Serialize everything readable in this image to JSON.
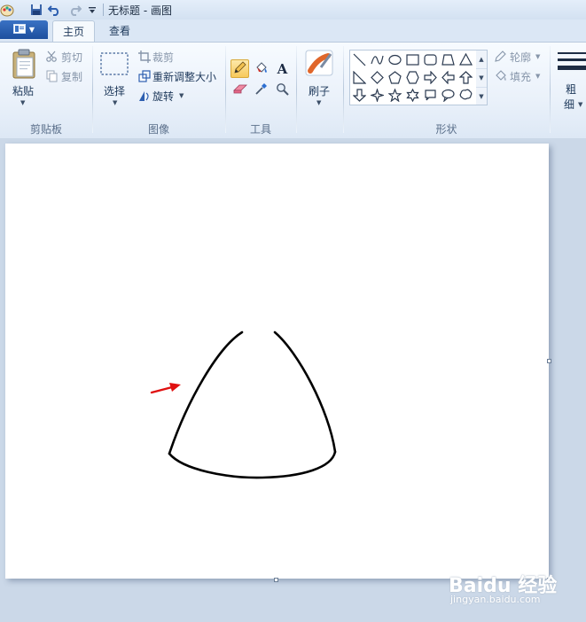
{
  "titlebar": {
    "title": "无标题 - 画图",
    "icons": [
      "paint-app-icon",
      "save-icon",
      "undo-icon",
      "redo-icon",
      "customize-dropdown-icon"
    ]
  },
  "tabs": {
    "app_menu_icon": "menu-icon",
    "items": [
      {
        "label": "主页",
        "active": true
      },
      {
        "label": "查看",
        "active": false
      }
    ]
  },
  "ribbon": {
    "clipboard": {
      "paste_label": "粘贴",
      "cut_label": "剪切",
      "copy_label": "复制",
      "group_label": "剪贴板"
    },
    "image": {
      "select_label": "选择",
      "crop_label": "裁剪",
      "resize_label": "重新调整大小",
      "rotate_label": "旋转",
      "group_label": "图像"
    },
    "tools": {
      "group_label": "工具",
      "items": [
        "pencil-icon",
        "fill-icon",
        "text-icon",
        "eraser-icon",
        "color-picker-icon",
        "magnifier-icon"
      ],
      "selected": "pencil-icon"
    },
    "brushes": {
      "label": "刷子"
    },
    "shapes": {
      "group_label": "形状",
      "outline_label": "轮廓",
      "fill_label": "填充"
    },
    "size": {
      "label_line1": "粗",
      "label_line2": "细"
    }
  },
  "canvas": {
    "background": "#ffffff",
    "stroke_color": "#000000",
    "arrow_color": "#e01010"
  },
  "watermark": {
    "logo": "Baidu 经验",
    "url": "jingyan.baidu.com"
  }
}
